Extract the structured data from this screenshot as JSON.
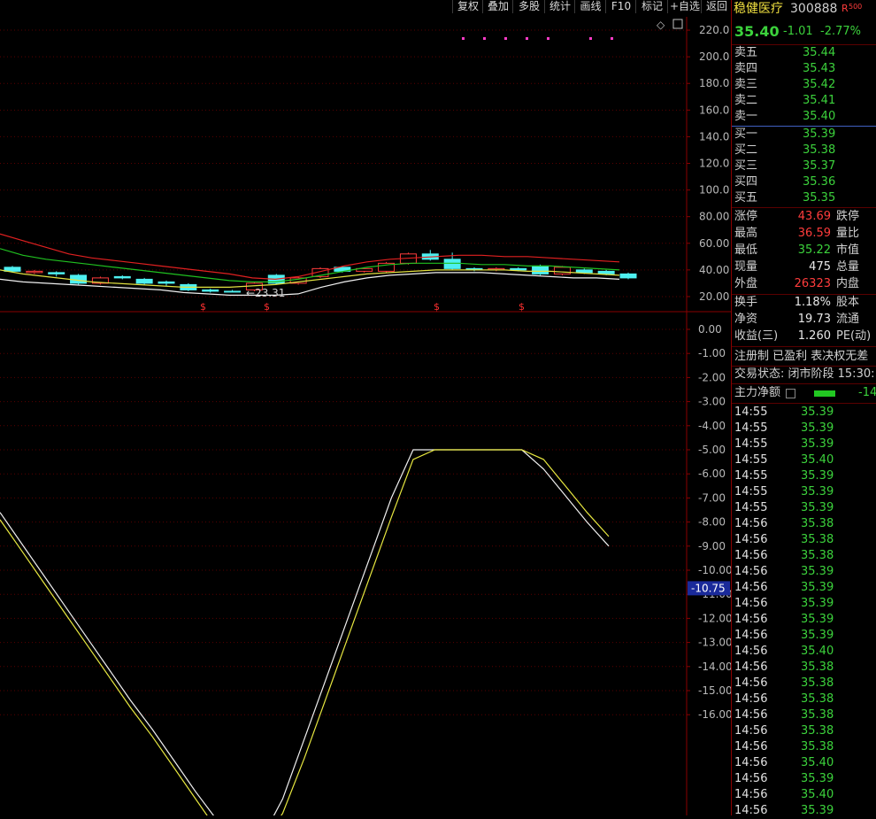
{
  "toolbar": [
    "复权",
    "叠加",
    "多股",
    "统计",
    "画线",
    "F10",
    "标记",
    "+自选",
    "返回"
  ],
  "stock": {
    "name": "稳健医疗",
    "code": "300888",
    "badge": "R",
    "badge_sub": "500",
    "price": "35.40",
    "change": "-1.01",
    "change_pct": "-2.77%"
  },
  "asks": [
    {
      "label": "卖五",
      "price": "35.44"
    },
    {
      "label": "卖四",
      "price": "35.43"
    },
    {
      "label": "卖三",
      "price": "35.42"
    },
    {
      "label": "卖二",
      "price": "35.41"
    },
    {
      "label": "卖一",
      "price": "35.40"
    }
  ],
  "bids": [
    {
      "label": "买一",
      "price": "35.39"
    },
    {
      "label": "买二",
      "price": "35.38"
    },
    {
      "label": "买三",
      "price": "35.37"
    },
    {
      "label": "买四",
      "price": "35.36"
    },
    {
      "label": "买五",
      "price": "35.35"
    }
  ],
  "stats": [
    {
      "l1": "涨停",
      "v1": "43.69",
      "c1": "red",
      "l2": "跌停"
    },
    {
      "l1": "最高",
      "v1": "36.59",
      "c1": "red",
      "l2": "量比"
    },
    {
      "l1": "最低",
      "v1": "35.22",
      "c1": "green",
      "l2": "市值"
    },
    {
      "l1": "现量",
      "v1": "475",
      "c1": "white",
      "l2": "总量"
    },
    {
      "l1": "外盘",
      "v1": "26323",
      "c1": "red",
      "l2": "内盘"
    }
  ],
  "fundamentals": [
    {
      "l1": "换手",
      "v1": "1.18%",
      "l2": "股本"
    },
    {
      "l1": "净资",
      "v1": "19.73",
      "l2": "流通"
    },
    {
      "l1": "收益(三)",
      "v1": "1.260",
      "l2": "PE(动)"
    }
  ],
  "tags": "注册制 已盈利 表决权无差",
  "trade_status": "交易状态: 闭市阶段 15:30:",
  "main_net": {
    "label": "主力净额",
    "value": "-14"
  },
  "ticks": [
    {
      "t": "14:55",
      "p": "35.39"
    },
    {
      "t": "14:55",
      "p": "35.39"
    },
    {
      "t": "14:55",
      "p": "35.39"
    },
    {
      "t": "14:55",
      "p": "35.40"
    },
    {
      "t": "14:55",
      "p": "35.39"
    },
    {
      "t": "14:55",
      "p": "35.39"
    },
    {
      "t": "14:55",
      "p": "35.39"
    },
    {
      "t": "14:56",
      "p": "35.38"
    },
    {
      "t": "14:56",
      "p": "35.38"
    },
    {
      "t": "14:56",
      "p": "35.38"
    },
    {
      "t": "14:56",
      "p": "35.39"
    },
    {
      "t": "14:56",
      "p": "35.39"
    },
    {
      "t": "14:56",
      "p": "35.39"
    },
    {
      "t": "14:56",
      "p": "35.39"
    },
    {
      "t": "14:56",
      "p": "35.39"
    },
    {
      "t": "14:56",
      "p": "35.40"
    },
    {
      "t": "14:56",
      "p": "35.38"
    },
    {
      "t": "14:56",
      "p": "35.38"
    },
    {
      "t": "14:56",
      "p": "35.38"
    },
    {
      "t": "14:56",
      "p": "35.38"
    },
    {
      "t": "14:56",
      "p": "35.38"
    },
    {
      "t": "14:56",
      "p": "35.38"
    },
    {
      "t": "14:56",
      "p": "35.40"
    },
    {
      "t": "14:56",
      "p": "35.39"
    },
    {
      "t": "14:56",
      "p": "35.40"
    },
    {
      "t": "14:56",
      "p": "35.39"
    }
  ],
  "chart_data": [
    {
      "type": "candlestick",
      "ylim": [
        10,
        230
      ],
      "yticks": [
        "220.0",
        "200.0",
        "180.0",
        "160.0",
        "140.0",
        "120.0",
        "100.0",
        "80.00",
        "60.00",
        "40.00",
        "20.00"
      ],
      "annotation": "←23.31",
      "markers": [
        "$",
        "$",
        "$",
        "$"
      ],
      "candles": [
        {
          "o": 42,
          "c": 39,
          "h": 43,
          "l": 38
        },
        {
          "o": 38,
          "c": 39,
          "h": 40,
          "l": 37
        },
        {
          "o": 38,
          "c": 37,
          "h": 39,
          "l": 35
        },
        {
          "o": 36,
          "c": 30,
          "h": 37,
          "l": 29
        },
        {
          "o": 30,
          "c": 34,
          "h": 35,
          "l": 29
        },
        {
          "o": 35,
          "c": 34,
          "h": 36,
          "l": 33
        },
        {
          "o": 33,
          "c": 30,
          "h": 34,
          "l": 29
        },
        {
          "o": 31,
          "c": 30,
          "h": 32,
          "l": 28
        },
        {
          "o": 29,
          "c": 25,
          "h": 30,
          "l": 24
        },
        {
          "o": 25,
          "c": 24,
          "h": 26,
          "l": 23
        },
        {
          "o": 24,
          "c": 23.5,
          "h": 25,
          "l": 23.3
        },
        {
          "o": 25,
          "c": 30,
          "h": 31,
          "l": 24
        },
        {
          "o": 36,
          "c": 30,
          "h": 37,
          "l": 29
        },
        {
          "o": 30,
          "c": 34,
          "h": 35,
          "l": 29
        },
        {
          "o": 35,
          "c": 41,
          "h": 42,
          "l": 34
        },
        {
          "o": 42,
          "c": 39,
          "h": 43,
          "l": 38
        },
        {
          "o": 39,
          "c": 41,
          "h": 42,
          "l": 38
        },
        {
          "o": 39,
          "c": 45,
          "h": 46,
          "l": 38
        },
        {
          "o": 45,
          "c": 52,
          "h": 53,
          "l": 44
        },
        {
          "o": 52,
          "c": 48,
          "h": 55,
          "l": 47
        },
        {
          "o": 48,
          "c": 41,
          "h": 53,
          "l": 40
        },
        {
          "o": 41,
          "c": 40,
          "h": 42,
          "l": 39
        },
        {
          "o": 40,
          "c": 41,
          "h": 42,
          "l": 39
        },
        {
          "o": 41,
          "c": 40,
          "h": 42,
          "l": 39
        },
        {
          "o": 43,
          "c": 37,
          "h": 44,
          "l": 36
        },
        {
          "o": 37,
          "c": 42,
          "h": 43,
          "l": 36
        },
        {
          "o": 40,
          "c": 38,
          "h": 41,
          "l": 37
        },
        {
          "o": 39,
          "c": 37,
          "h": 40,
          "l": 36
        },
        {
          "o": 37,
          "c": 34,
          "h": 38,
          "l": 33
        }
      ],
      "ma_red": [
        67,
        62,
        57,
        52,
        49,
        47,
        45,
        43,
        41,
        39,
        37,
        34,
        33,
        35,
        39,
        43,
        46,
        48,
        49,
        50,
        51,
        51,
        50,
        50,
        49,
        48,
        47,
        46
      ],
      "ma_green": [
        56,
        51,
        48,
        46,
        44,
        42,
        40,
        38,
        36,
        34,
        32,
        31,
        31,
        33,
        36,
        39,
        42,
        44,
        45,
        45,
        45,
        44,
        44,
        43,
        43,
        42,
        41,
        40
      ],
      "ma_yellow": [
        40,
        37,
        35,
        33,
        31,
        30,
        29,
        28,
        27,
        27,
        27,
        28,
        29,
        31,
        33,
        35,
        37,
        38,
        39,
        40,
        40,
        40,
        40,
        39,
        39,
        38,
        37,
        36
      ],
      "ma_white": [
        33,
        31,
        30,
        29,
        28,
        27,
        26,
        25,
        23,
        22,
        21,
        21,
        21,
        22,
        27,
        31,
        34,
        36,
        37,
        38,
        38,
        38,
        37,
        36,
        35,
        34,
        34,
        33
      ]
    },
    {
      "type": "line",
      "ylim": [
        -17,
        0.5
      ],
      "yticks": [
        "0.00",
        "-1.00",
        "-2.00",
        "-3.00",
        "-4.00",
        "-5.00",
        "-6.00",
        "-7.00",
        "-8.00",
        "-9.00",
        "-10.00",
        "-11.00",
        "-12.00",
        "-13.00",
        "-14.00",
        "-15.00",
        "-16.00"
      ],
      "current_label": "-10.75",
      "x": [
        0,
        1,
        2,
        3,
        4,
        5,
        6,
        7,
        8,
        9,
        10,
        11,
        12,
        13,
        14,
        15,
        16,
        17,
        18,
        19,
        20,
        21,
        22,
        23,
        24,
        25,
        26,
        27,
        28
      ],
      "series": [
        {
          "values": [
            -7.6,
            -8.9,
            -10.2,
            -11.5,
            -12.8,
            -14.1,
            -15.4,
            -16.6,
            -17.9,
            -19.2,
            -20.4,
            -21.7,
            -21.2,
            -19.5,
            -17.0,
            -14.5,
            -12.0,
            -9.5,
            -7.0,
            -5.0,
            -5.0,
            -5.0,
            -5.0,
            -5.0,
            -5.0,
            -5.8,
            -6.9,
            -8.0,
            -9.0
          ]
        },
        {
          "values": [
            -7.9,
            -9.2,
            -10.5,
            -11.8,
            -13.1,
            -14.4,
            -15.7,
            -16.9,
            -18.2,
            -19.5,
            -20.8,
            -21.4,
            -21.4,
            -20.1,
            -17.8,
            -15.3,
            -12.8,
            -10.3,
            -7.8,
            -5.4,
            -5.0,
            -5.0,
            -5.0,
            -5.0,
            -5.0,
            -5.4,
            -6.5,
            -7.6,
            -8.6
          ]
        }
      ]
    }
  ]
}
